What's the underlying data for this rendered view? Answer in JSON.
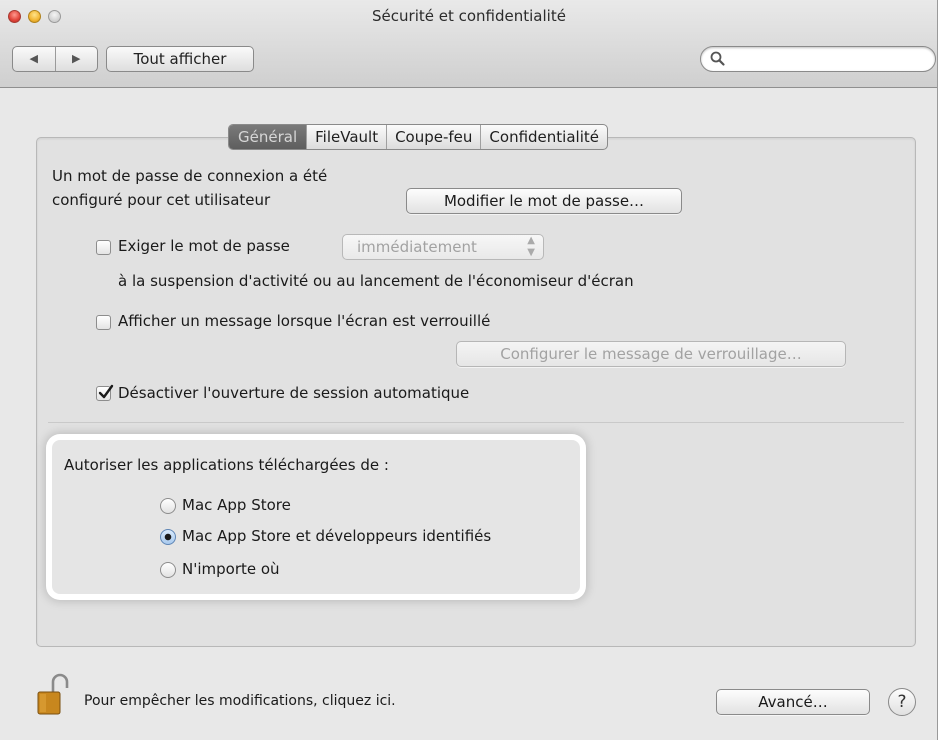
{
  "window": {
    "title": "Sécurité et confidentialité",
    "show_all": "Tout afficher",
    "nav_back": "◀",
    "nav_forward": "▶",
    "search": {
      "value": "",
      "placeholder": ""
    }
  },
  "tabs": [
    "Général",
    "FileVault",
    "Coupe-feu",
    "Confidentialité"
  ],
  "active_tab": "Général",
  "general": {
    "password_line1": "Un mot de passe de connexion a été",
    "password_line2": "configuré pour cet utilisateur",
    "change_password_button": "Modifier le mot de passe…",
    "require_password": {
      "label": "Exiger le mot de passe",
      "checked": false
    },
    "require_password_popup": {
      "value": "immédiatement",
      "enabled": false
    },
    "require_password_suffix": "à la suspension d'activité ou au lancement de l'économiseur d'écran",
    "show_message": {
      "label": "Afficher un message lorsque l'écran est verrouillé",
      "checked": false
    },
    "configure_message_button": {
      "label": "Configurer le message de verrouillage…",
      "enabled": false
    },
    "disable_auto_login": {
      "label": "Désactiver l'ouverture de session automatique",
      "checked": true
    }
  },
  "allow_apps": {
    "heading": "Autoriser les applications téléchargées de :",
    "options": [
      "Mac App Store",
      "Mac App Store et développeurs identifiés",
      "N'importe où"
    ],
    "selected_index": 1
  },
  "footer": {
    "lock_text": "Pour empêcher les modifications, cliquez ici.",
    "advanced_button": "Avancé…",
    "help_button": "?"
  },
  "colors": {
    "accent": "#5f86b5",
    "active_tab": "#6b6b6b",
    "highlight_ring": "#ffffff"
  }
}
